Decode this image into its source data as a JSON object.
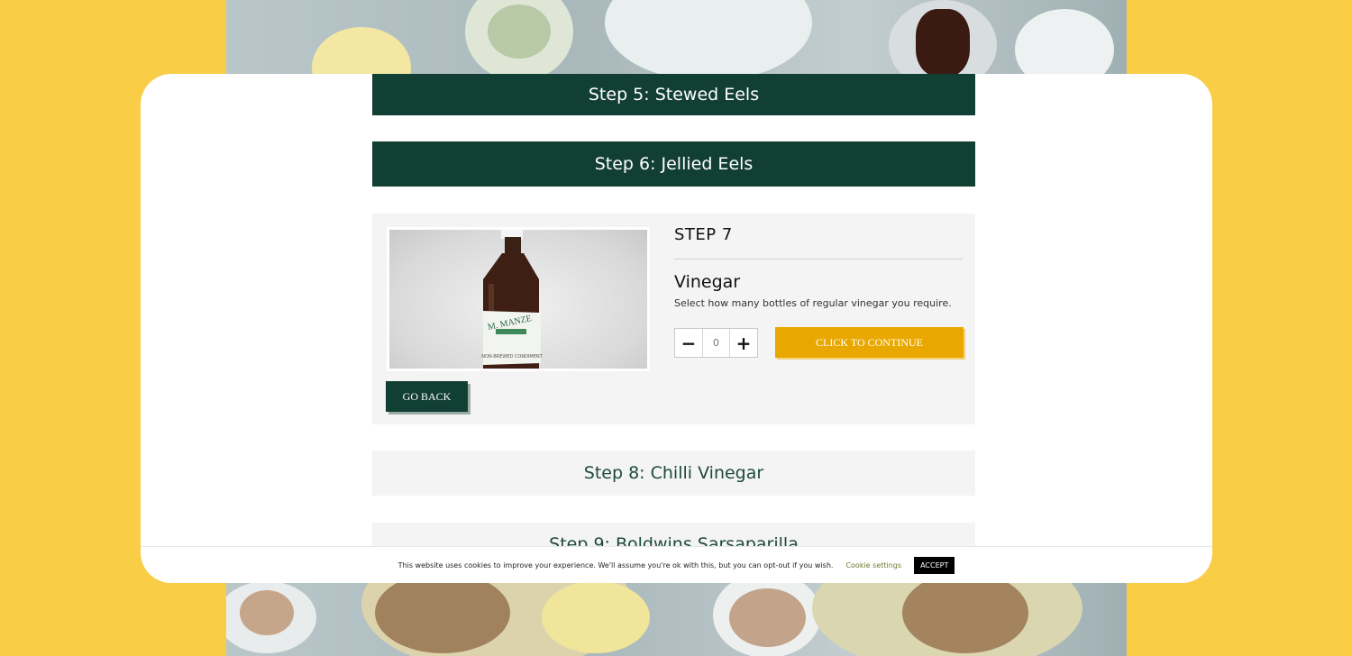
{
  "steps": {
    "step5": "Step 5: Stewed Eels",
    "step6": "Step 6: Jellied Eels",
    "step8": "Step 8: Chilli Vinegar",
    "step9": "Step 9: Boldwins Sarsaparilla"
  },
  "current_step": {
    "label": "STEP 7",
    "product_name": "Vinegar",
    "description": "Select how many bottles of regular vinegar you require.",
    "quantity": "0",
    "minus_symbol": "−",
    "plus_symbol": "+",
    "continue_label": "CLICK TO CONTINUE",
    "back_label": "GO BACK",
    "bottle_label_text": "M. MANZE",
    "bottle_sub_text": "NON-BREWED CONDIMENT"
  },
  "cookie_banner": {
    "message": "This website uses cookies to improve your experience. We'll assume you're ok with this, but you can opt-out if you wish.",
    "settings_label": "Cookie settings",
    "accept_label": "ACCEPT"
  },
  "colors": {
    "background": "#f9cd45",
    "dark_green": "#123f33",
    "accent_yellow": "#e9a800",
    "panel_grey": "#f4f4f4"
  }
}
